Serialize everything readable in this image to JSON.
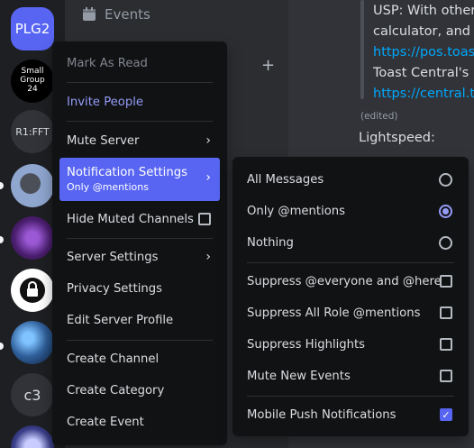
{
  "servers": [
    {
      "label": "PLG2",
      "kind": "text",
      "bg": "#5865f2",
      "color": "#ffffff"
    },
    {
      "label": "Small Group 24",
      "kind": "avatar-text",
      "bg": "#000000",
      "color": "#ffffff"
    },
    {
      "label": "R1:FFT",
      "kind": "text",
      "bg": "#313338",
      "color": "#dbdee1"
    },
    {
      "label": "",
      "kind": "image",
      "bg": "#6b7aa1",
      "color": "#ffffff"
    },
    {
      "label": "",
      "kind": "image",
      "bg": "#5a2a78",
      "color": "#ffffff"
    },
    {
      "label": "",
      "kind": "image",
      "bg": "#ffffff",
      "color": "#111"
    },
    {
      "label": "",
      "kind": "image",
      "bg": "#2f5f9a",
      "color": "#ffffff"
    },
    {
      "label": "c3",
      "kind": "text",
      "bg": "#313338",
      "color": "#dbdee1"
    },
    {
      "label": "",
      "kind": "image",
      "bg": "#3b3f8a",
      "color": "#ffffff"
    }
  ],
  "channel": {
    "events_label": "Events"
  },
  "chat": {
    "lines": [
      {
        "text": "USP: With other",
        "link": false
      },
      {
        "text": "calculator, and a",
        "link": false
      },
      {
        "text": "https://pos.toas",
        "link": true
      },
      {
        "text": "Toast Central's D",
        "link": false
      },
      {
        "text": "https://central.t",
        "link": true
      }
    ],
    "edited": "(edited)",
    "lightspeed": "Lightspeed:"
  },
  "menu": {
    "mark_as_read": "Mark As Read",
    "invite_people": "Invite People",
    "mute_server": "Mute Server",
    "notification_settings": "Notification Settings",
    "notification_sub": "Only @mentions",
    "hide_muted": "Hide Muted Channels",
    "server_settings": "Server Settings",
    "privacy_settings": "Privacy Settings",
    "edit_profile": "Edit Server Profile",
    "create_channel": "Create Channel",
    "create_category": "Create Category",
    "create_event": "Create Event"
  },
  "submenu": {
    "all_messages": "All Messages",
    "only_mentions": "Only @mentions",
    "nothing": "Nothing",
    "suppress_everyone": "Suppress @everyone and @here",
    "suppress_roles": "Suppress All Role @mentions",
    "suppress_highlights": "Suppress Highlights",
    "mute_new_events": "Mute New Events",
    "mobile_push": "Mobile Push Notifications"
  },
  "colors": {
    "accent": "#5865f2",
    "menu_bg": "#111214",
    "link": "#00a8fc"
  }
}
